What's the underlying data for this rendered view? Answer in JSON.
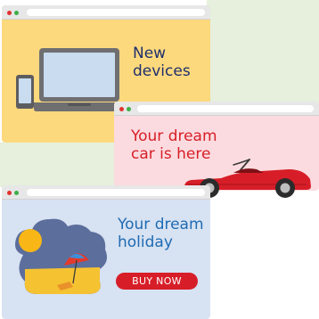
{
  "colors": {
    "background": "#ffffff",
    "background_panel": "#e6f0dd",
    "titlebar": "#e7e7e7",
    "dot_red": "#e0322f",
    "dot_green": "#3fae49",
    "devices_window_bg": "#fdd97d",
    "car_window_bg": "#fbdbdf",
    "holiday_window_bg": "#d7e2f2",
    "devices_text": "#1e2f6e",
    "car_text": "#d71e28",
    "holiday_text": "#1f6bb3",
    "button": "#d71e28",
    "car_body": "#d71e28"
  },
  "devices_window": {
    "headline_line1": "New",
    "headline_line2": "devices",
    "illustration": "laptop-and-phone"
  },
  "car_window": {
    "headline_line1": "Your dream",
    "headline_line2": "car is here",
    "illustration": "red-convertible-car"
  },
  "holiday_window": {
    "headline_line1": "Your dream",
    "headline_line2": "holiday",
    "button_label": "BUY NOW",
    "illustration": "beach-with-sun-and-umbrella"
  }
}
